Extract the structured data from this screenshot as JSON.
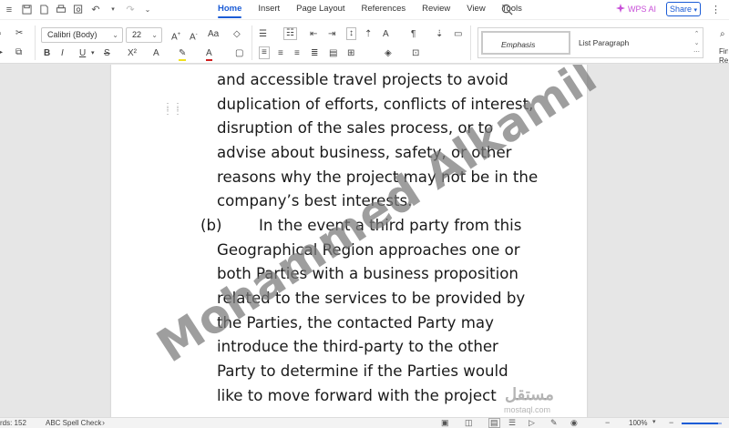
{
  "menubar": {
    "tabs": [
      {
        "label": "Home",
        "active": true
      },
      {
        "label": "Insert",
        "active": false
      },
      {
        "label": "Page Layout",
        "active": false
      },
      {
        "label": "References",
        "active": false
      },
      {
        "label": "Review",
        "active": false
      },
      {
        "label": "View",
        "active": false
      },
      {
        "label": "Tools",
        "active": false
      }
    ],
    "wps_ai_label": "WPS AI",
    "share_label": "Share"
  },
  "ribbon": {
    "font_name": "Calibri (Body)",
    "font_size": "22",
    "styles": [
      {
        "label": "Emphasis"
      },
      {
        "label": "List Paragraph"
      }
    ],
    "find_replace_label": "Fin Rep"
  },
  "document": {
    "para1_lines": [
      "and accessible travel projects to avoid",
      "duplication of efforts, conflicts of interest,",
      "disruption of the sales process, or to",
      "advise about business, safety, or other",
      "reasons why the project may not be in the",
      "company’s best interests."
    ],
    "item_b_label": "(b)",
    "para2_lines": [
      "In the event a third party from this",
      "Geographical Region approaches one or",
      "both Parties with a business proposition",
      "related to the services to be provided by",
      "the Parties, the contacted Party may",
      "introduce the third-party to the other",
      "Party to determine if the Parties would",
      "like to move forward with the project"
    ],
    "watermark": "Mohammed Alkamil",
    "logo_text": "مستقل",
    "logo_sub": "mostaql.com"
  },
  "statusbar": {
    "word_count": "rds: 152",
    "spell_check": "ABC Spell Check",
    "zoom": "100%"
  }
}
